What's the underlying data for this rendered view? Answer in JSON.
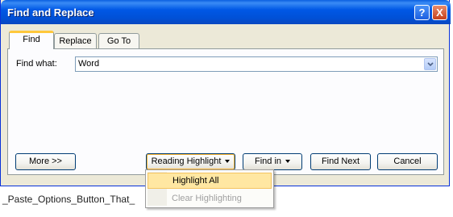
{
  "window": {
    "title": "Find and Replace",
    "help_label": "?",
    "close_label": "X"
  },
  "tabs": [
    {
      "label": "Find",
      "active": true
    },
    {
      "label": "Replace",
      "active": false
    },
    {
      "label": "Go To",
      "active": false
    }
  ],
  "find": {
    "label": "Find what:",
    "value": "Word"
  },
  "buttons": {
    "more": "More >>",
    "reading_highlight": "Reading Highlight",
    "find_in": "Find in",
    "find_next": "Find Next",
    "cancel": "Cancel"
  },
  "menu": {
    "items": [
      {
        "label": "Highlight All",
        "enabled": true,
        "hovered": true
      },
      {
        "label": "Clear Highlighting",
        "enabled": false,
        "hovered": false
      }
    ]
  },
  "background_document": {
    "text": "_Paste_Options_Button_That_"
  },
  "colors": {
    "titlebar": "#0058e6",
    "dialog_face": "#ece9d8",
    "active_tab_accent": "#ffc83c",
    "menu_highlight": "#ffe7a2"
  }
}
